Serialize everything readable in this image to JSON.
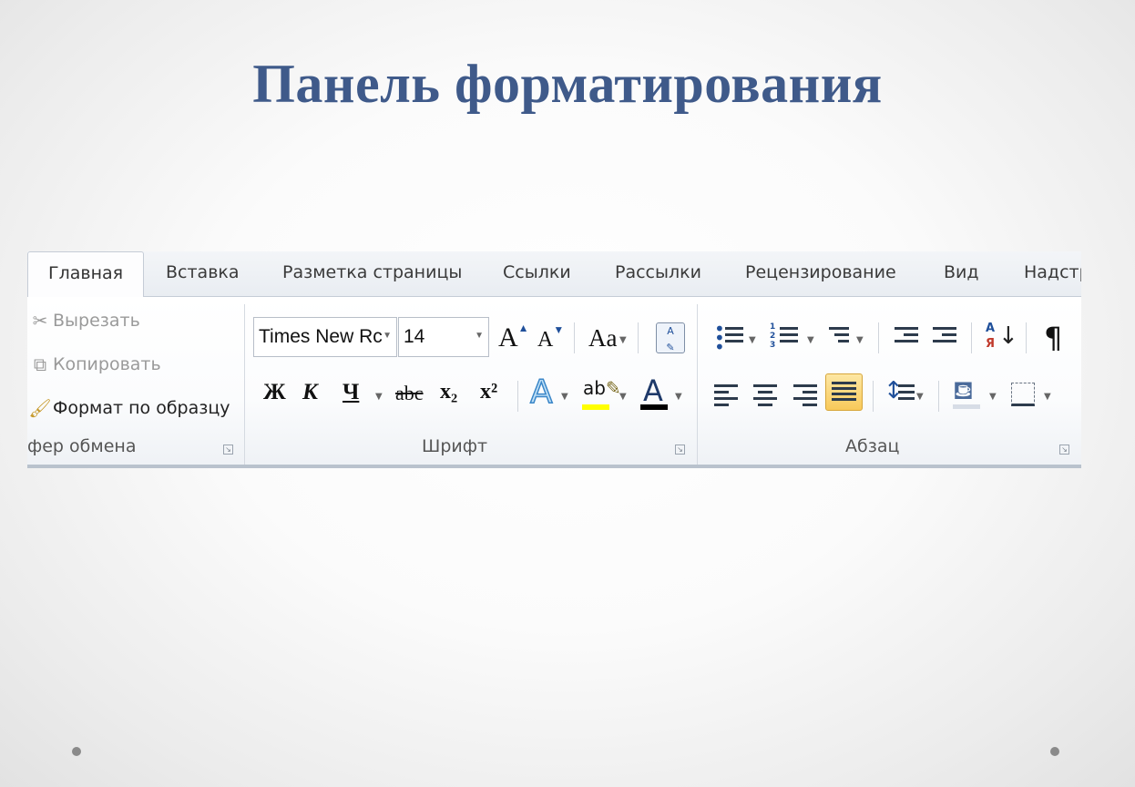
{
  "slide": {
    "title": "Панель форматирования"
  },
  "tabs": [
    "Главная",
    "Вставка",
    "Разметка страницы",
    "Ссылки",
    "Рассылки",
    "Рецензирование",
    "Вид",
    "Надстр"
  ],
  "clipboard": {
    "cut": "Вырезать",
    "copy": "Копировать",
    "format_painter": "Формат по образцу",
    "label": "фер обмена"
  },
  "font": {
    "family": "Times New Rc",
    "size": "14",
    "grow_label": "A",
    "shrink_label": "A",
    "case_label": "Aa",
    "bold": "Ж",
    "italic": "К",
    "underline": "Ч",
    "strikethrough": "abc",
    "subscript": "x₂",
    "superscript": "x²",
    "effects": "A",
    "highlight": "ab",
    "color": "A",
    "label": "Шрифт"
  },
  "paragraph": {
    "sort_top": "А",
    "sort_bottom": "Я",
    "pilcrow": "¶",
    "label": "Абзац"
  },
  "colors": {
    "title": "#3f5a8a",
    "highlight_yellow": "#ffff00",
    "font_color_bar": "#000000",
    "active_button": "#f8c95a"
  },
  "icons": {
    "cut": "scissors-icon",
    "copy": "copy-icon",
    "format_painter": "brush-icon",
    "launcher": "dialog-launcher-icon"
  }
}
